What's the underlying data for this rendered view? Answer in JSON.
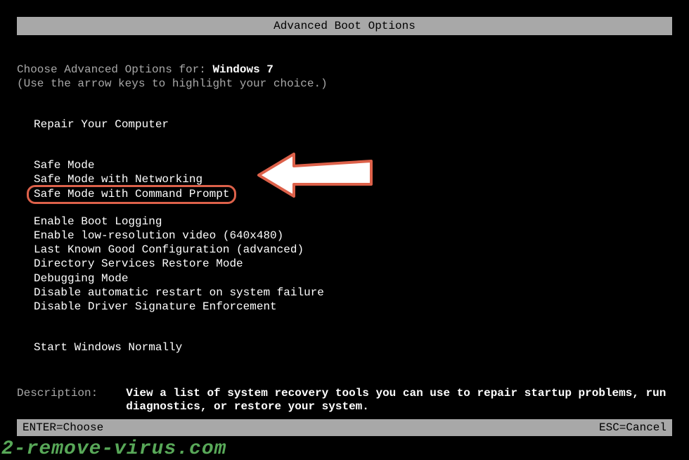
{
  "title": "Advanced Boot Options",
  "prompt": "Choose Advanced Options for: ",
  "os": "Windows 7",
  "hint": "(Use the arrow keys to highlight your choice.)",
  "groups": [
    [
      "Repair Your Computer"
    ],
    [
      "Safe Mode",
      "Safe Mode with Networking",
      "Safe Mode with Command Prompt"
    ],
    [
      "Enable Boot Logging",
      "Enable low-resolution video (640x480)",
      "Last Known Good Configuration (advanced)",
      "Directory Services Restore Mode",
      "Debugging Mode",
      "Disable automatic restart on system failure",
      "Disable Driver Signature Enforcement"
    ],
    [
      "Start Windows Normally"
    ]
  ],
  "highlighted_option": "Safe Mode with Command Prompt",
  "description_label": "Description:",
  "description_text": "View a list of system recovery tools you can use to repair startup problems, run diagnostics, or restore your system.",
  "footer_left": "ENTER=Choose",
  "footer_right": "ESC=Cancel",
  "watermark": "2-remove-virus.com",
  "colors": {
    "highlight_border": "#dd614a",
    "watermark": "#58a858"
  }
}
